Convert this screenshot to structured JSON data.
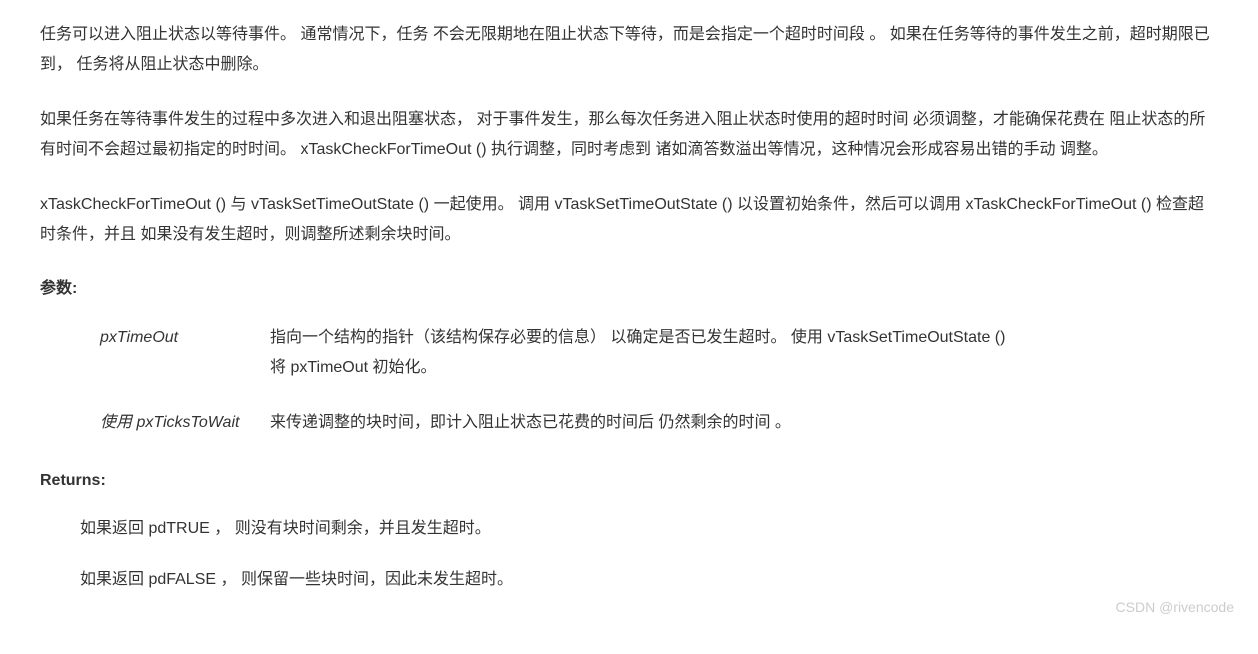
{
  "paragraphs": {
    "p1": "任务可以进入阻止状态以等待事件。 通常情况下，任务 不会无限期地在阻止状态下等待，而是会指定一个超时时间段 。 如果在任务等待的事件发生之前，超时期限已到， 任务将从阻止状态中删除。",
    "p2": "如果任务在等待事件发生的过程中多次进入和退出阻塞状态， 对于事件发生，那么每次任务进入阻止状态时使用的超时时间 必须调整，才能确保花费在 阻止状态的所有时间不会超过最初指定的时时间。 xTaskCheckForTimeOut () 执行调整，同时考虑到 诸如滴答数溢出等情况，这种情况会形成容易出错的手动 调整。",
    "p3": "xTaskCheckForTimeOut () 与 vTaskSetTimeOutState () 一起使用。 调用 vTaskSetTimeOutState () 以设置初始条件，然后可以调用 xTaskCheckForTimeOut () 检查超时条件，并且 如果没有发生超时，则调整所述剩余块时间。"
  },
  "sections": {
    "params_header": "参数:",
    "returns_header": "Returns:"
  },
  "params": [
    {
      "name": "pxTimeOut",
      "desc": "指向一个结构的指针（该结构保存必要的信息） 以确定是否已发生超时。 使用 vTaskSetTimeOutState () 将 pxTimeOut 初始化。"
    },
    {
      "name": "使用 pxTicksToWait",
      "desc": "来传递调整的块时间，即计入阻止状态已花费的时间后 仍然剩余的时间 。"
    }
  ],
  "returns": [
    "如果返回 pdTRUE ， 则没有块时间剩余，并且发生超时。",
    "如果返回 pdFALSE ， 则保留一些块时间，因此未发生超时。"
  ],
  "watermark": "CSDN @rivencode"
}
